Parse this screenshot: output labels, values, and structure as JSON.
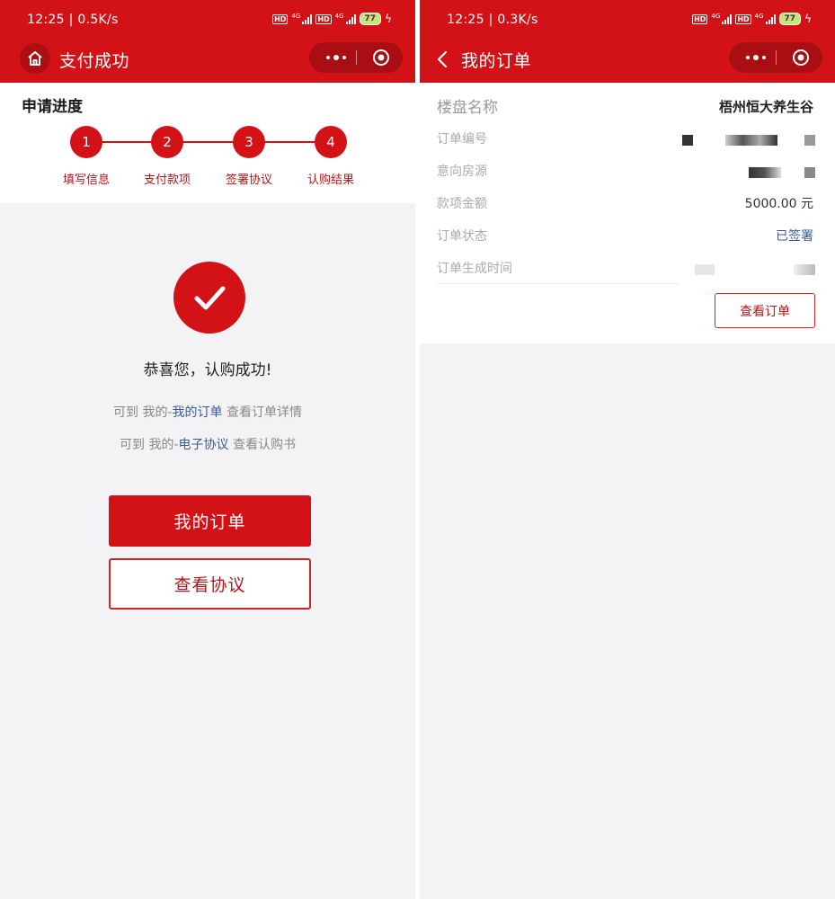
{
  "status_left": {
    "time": "12:25 | 0.5K/s",
    "battery": "77"
  },
  "status_right": {
    "time": "12:25 | 0.3K/s",
    "battery": "77"
  },
  "status_icons": {
    "hd": "HD",
    "net": "4G"
  },
  "left": {
    "nav_title": "支付成功",
    "progress_title": "申请进度",
    "steps": [
      {
        "num": "1",
        "label": "填写信息"
      },
      {
        "num": "2",
        "label": "支付款项"
      },
      {
        "num": "3",
        "label": "签署协议"
      },
      {
        "num": "4",
        "label": "认购结果"
      }
    ],
    "success_title": "恭喜您，认购成功!",
    "hint1": {
      "pre": "可到 我的-",
      "link": "我的订单",
      "post": " 查看订单详情"
    },
    "hint2": {
      "pre": "可到 我的-",
      "link": "电子协议",
      "post": " 查看认购书"
    },
    "primary_button": "我的订单",
    "secondary_button": "查看协议"
  },
  "right": {
    "nav_title": "我的订单",
    "rows": [
      {
        "label": "楼盘名称",
        "value": "梧州恒大养生谷"
      },
      {
        "label": "订单编号",
        "value": ""
      },
      {
        "label": "意向房源",
        "value": ""
      },
      {
        "label": "款项金额",
        "value": "5000.00 元"
      },
      {
        "label": "订单状态",
        "value": "已签署"
      },
      {
        "label": "订单生成时间",
        "value": ""
      }
    ],
    "view_order_button": "查看订单"
  },
  "colors": {
    "brand_red": "#d31217",
    "link_blue": "#3a5a9a",
    "background": "#f3f3f5"
  },
  "icons": {
    "home": "home-icon",
    "back": "chevron-left-icon",
    "more": "more-dots-icon",
    "close": "target-circle-icon",
    "success": "checkmark-icon"
  }
}
